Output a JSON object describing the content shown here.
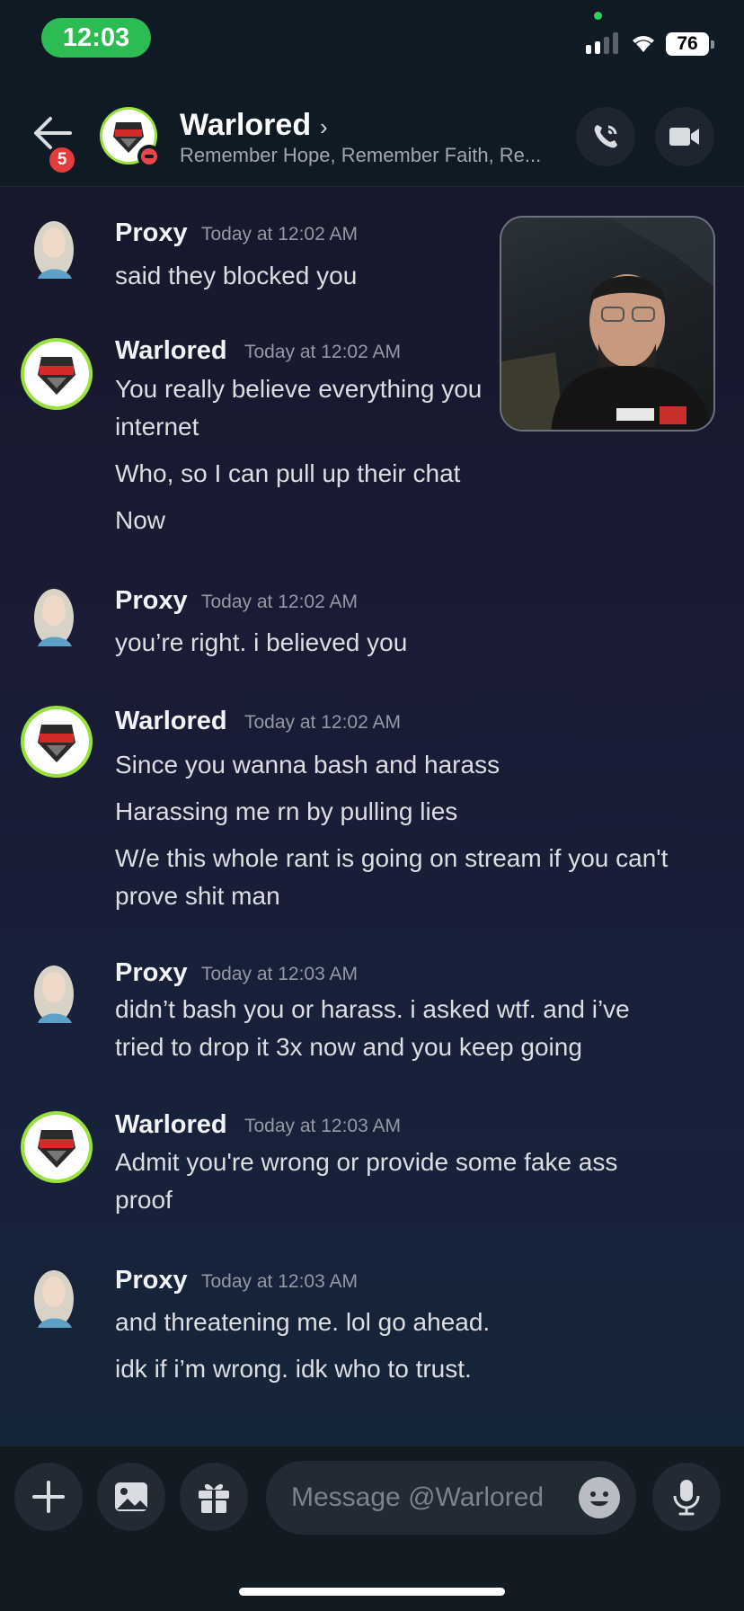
{
  "status_bar": {
    "time": "12:03",
    "battery": "76"
  },
  "header": {
    "badge_count": "5",
    "name": "Warlored",
    "chevron": "›",
    "status": "Remember Hope, Remember Faith, Re...",
    "icons": {
      "back": "arrow-left-icon",
      "call": "phone-icon",
      "video": "video-camera-icon"
    }
  },
  "messages": [
    {
      "author": "Proxy",
      "timestamp": "Today at 12:02 AM",
      "lines": [
        "said they blocked you"
      ]
    },
    {
      "author": "Warlored",
      "timestamp": "Today at 12:02 AM",
      "lines": [
        "You really believe everything you",
        "internet",
        "Who, so I can pull up their chat",
        "Now"
      ]
    },
    {
      "author": "Proxy",
      "timestamp": "Today at 12:02 AM",
      "lines": [
        "you’re right.  i  believed you"
      ]
    },
    {
      "author": "Warlored",
      "timestamp": "Today at 12:02 AM",
      "lines": [
        "Since you wanna bash and harass",
        "Harassing me rn by pulling lies",
        "W/e this whole rant is going on stream if you can't",
        "prove shit man"
      ]
    },
    {
      "author": "Proxy",
      "timestamp": "Today at 12:03 AM",
      "lines": [
        "didn’t bash you or harass. i asked wtf. and i’ve",
        "tried to drop it 3x now and you keep going"
      ]
    },
    {
      "author": "Warlored",
      "timestamp": "Today at 12:03 AM",
      "lines": [
        "Admit you're wrong or provide some fake ass",
        "proof"
      ]
    },
    {
      "author": "Proxy",
      "timestamp": "Today at 12:03 AM",
      "lines": [
        "and threatening me. lol go ahead.",
        "idk if i’m wrong. idk who to trust."
      ]
    }
  ],
  "composer": {
    "placeholder": "Message @Warlored",
    "icons": [
      "plus-icon",
      "image-icon",
      "gift-icon",
      "emoji-icon",
      "microphone-icon"
    ]
  },
  "colors": {
    "status_green": "#2dbb54",
    "badge_red": "#e33c3c",
    "background": "#1a1a33"
  }
}
